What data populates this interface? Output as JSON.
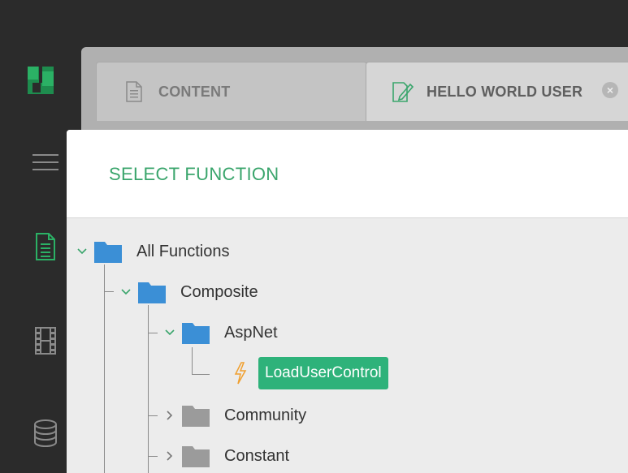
{
  "tabs": [
    {
      "label": "CONTENT",
      "icon": "document-icon"
    },
    {
      "label": "HELLO WORLD USER",
      "icon": "edit-document-icon"
    }
  ],
  "dialog": {
    "title": "SELECT FUNCTION"
  },
  "tree": {
    "root": "All Functions",
    "composite": "Composite",
    "aspnet": "AspNet",
    "function": "LoadUserControl",
    "community": "Community",
    "constant": "Constant"
  },
  "colors": {
    "accent": "#2eb27a",
    "title_green": "#3aa56c",
    "folder_blue": "#3b8fd6",
    "folder_gray": "#9b9b9b",
    "rail_bg": "#2b2b2b"
  }
}
